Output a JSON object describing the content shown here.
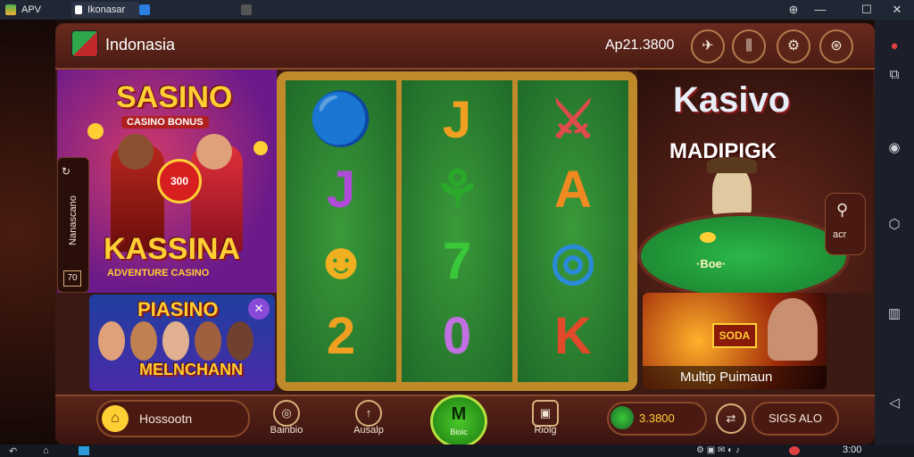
{
  "os_bar": {
    "tabs": [
      {
        "label": "APV"
      },
      {
        "label": "Ikonasar"
      },
      {
        "label": ""
      },
      {
        "label": ""
      }
    ],
    "window_controls": [
      "⊕",
      "—",
      "☐",
      "✕"
    ]
  },
  "header": {
    "app_title": "Indonasia",
    "balance": "Ap21.3800",
    "buttons": [
      "✈",
      "⫼",
      "⚙",
      "⊛"
    ]
  },
  "left_banner": {
    "title": "SASINO",
    "subtitle": "CASINO BONUS",
    "big_text": "KASSINA",
    "tagline": "ADVENTURE CASINO",
    "chip_text": "300",
    "side_label": "Nanascano",
    "side_badge": "70"
  },
  "left_small_banner": {
    "title": "PIASINO",
    "subtitle": "MELNCHANN",
    "badge": "✕"
  },
  "reels": [
    [
      "🔵",
      "J",
      "☻",
      "2"
    ],
    [
      "J",
      "⚘",
      "7",
      "0"
    ],
    [
      "⚔",
      "A",
      "◎",
      "K"
    ]
  ],
  "right_panel": {
    "title": "Kasivo",
    "subtitle": "MADIPIGK",
    "table_text": "·Boe·",
    "side_button_label": "acr"
  },
  "right_banner": {
    "badge": "SODA",
    "caption": "Multip Puimaun"
  },
  "controls": {
    "home_label": "Hossootn",
    "items": [
      {
        "icon": "◎",
        "label": "Bainbio"
      },
      {
        "icon": "↑",
        "label": "Ausalp"
      },
      {
        "icon": "M",
        "label": "Bioic"
      },
      {
        "icon": "▣",
        "label": "Riolg"
      }
    ],
    "coins": "3.3800",
    "arrow": "⇄",
    "bet_label": "SIGS ALO"
  },
  "bottom_bar": {
    "time": "3:00"
  },
  "colors": {
    "accent_gold": "#ffcf33",
    "frame_brown": "#3a1a12",
    "reel_green": "#2a7a30"
  }
}
